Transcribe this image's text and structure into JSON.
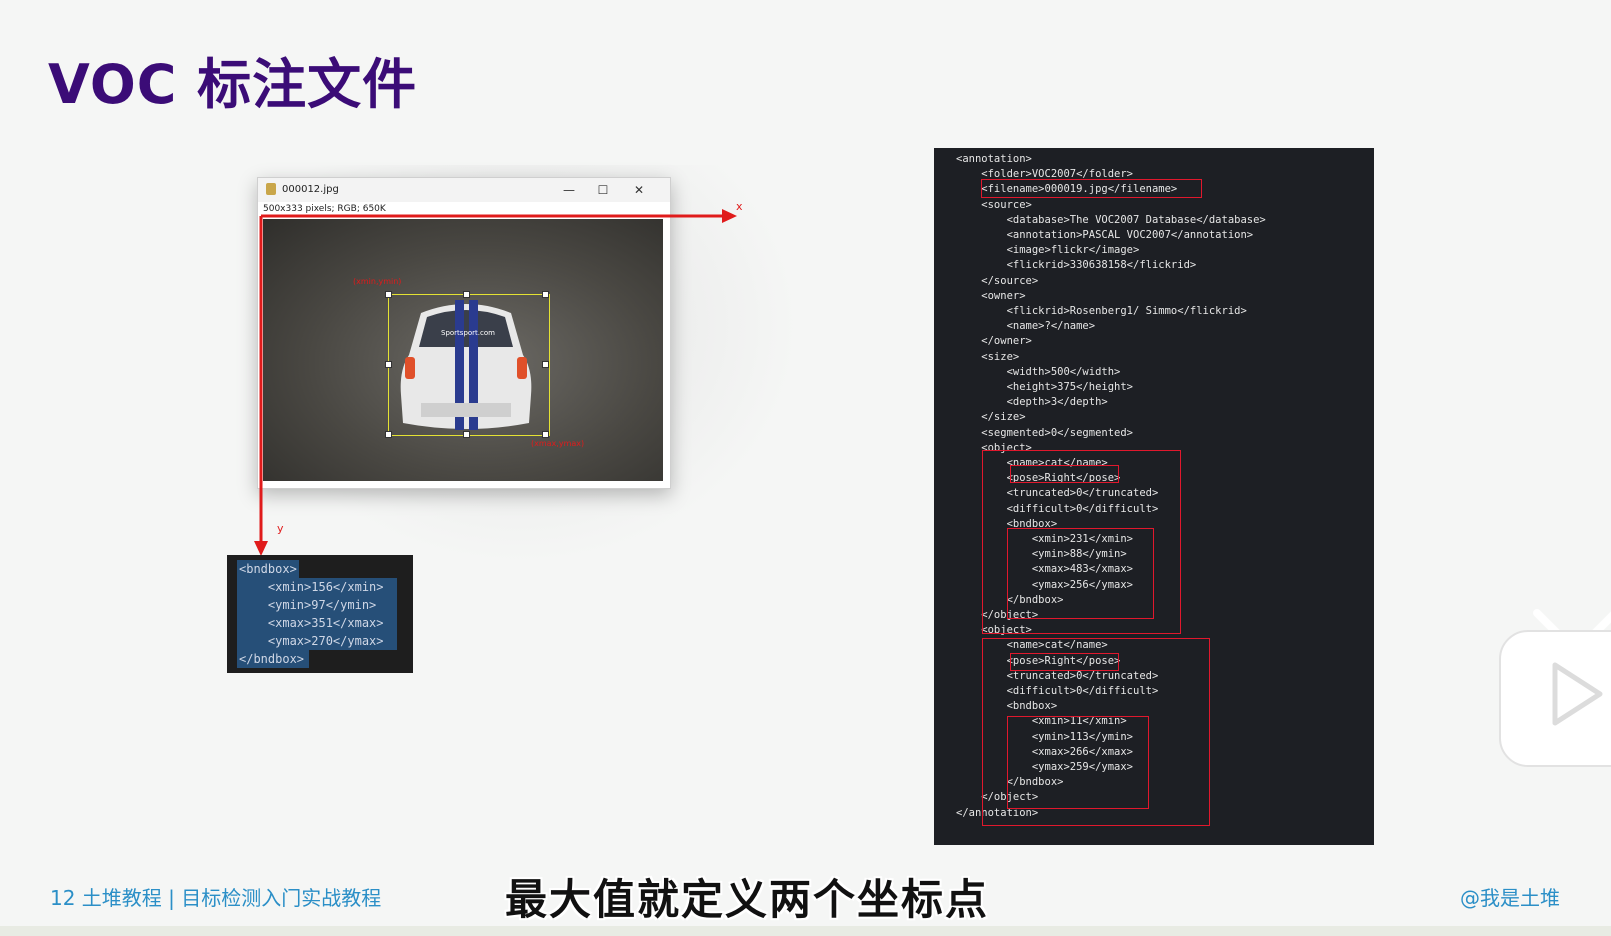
{
  "slide": {
    "title": "VOC 标注文件",
    "footer_left": "12  土堆教程 | 目标检测入门实战教程",
    "footer_right": "@我是土堆",
    "subtitle_caption": "最大值就定义两个坐标点"
  },
  "image_window": {
    "filename": "000012.jpg",
    "info": "500x333 pixels; RGB; 650K",
    "minimize_glyph": "—",
    "maximize_glyph": "☐",
    "close_glyph": "✕",
    "axis_x_label": "x",
    "axis_y_label": "y",
    "min_point_label": "(xmin,ymin)",
    "max_point_label": "(xmax,ymax)"
  },
  "bndbox_snippet": {
    "lines": [
      "<bndbox>",
      "    <xmin>156</xmin>",
      "    <ymin>97</ymin>",
      "    <xmax>351</xmax>",
      "    <ymax>270</ymax>",
      "</bndbox>"
    ]
  },
  "xml_file": {
    "lines": [
      "<annotation>",
      "    <folder>VOC2007</folder>",
      "    <filename>000019.jpg</filename>",
      "    <source>",
      "        <database>The VOC2007 Database</database>",
      "        <annotation>PASCAL VOC2007</annotation>",
      "        <image>flickr</image>",
      "        <flickrid>330638158</flickrid>",
      "    </source>",
      "    <owner>",
      "        <flickrid>Rosenberg1/ Simmo</flickrid>",
      "        <name>?</name>",
      "    </owner>",
      "    <size>",
      "        <width>500</width>",
      "        <height>375</height>",
      "        <depth>3</depth>",
      "    </size>",
      "    <segmented>0</segmented>",
      "    <object>",
      "        <name>cat</name>",
      "        <pose>Right</pose>",
      "        <truncated>0</truncated>",
      "        <difficult>0</difficult>",
      "        <bndbox>",
      "            <xmin>231</xmin>",
      "            <ymin>88</ymin>",
      "            <xmax>483</xmax>",
      "            <ymax>256</ymax>",
      "        </bndbox>",
      "    </object>",
      "    <object>",
      "        <name>cat</name>",
      "        <pose>Right</pose>",
      "        <truncated>0</truncated>",
      "        <difficult>0</difficult>",
      "        <bndbox>",
      "            <xmin>11</xmin>",
      "            <ymin>113</ymin>",
      "            <xmax>266</xmax>",
      "            <ymax>259</ymax>",
      "        </bndbox>",
      "    </object>",
      "</annotation>"
    ]
  },
  "colors": {
    "title": "#3b0c77",
    "footer": "#2b8fc7",
    "highlight_box": "#e0182d",
    "axis_arrow": "#e01b1b",
    "code_bg": "#1d1f24"
  }
}
